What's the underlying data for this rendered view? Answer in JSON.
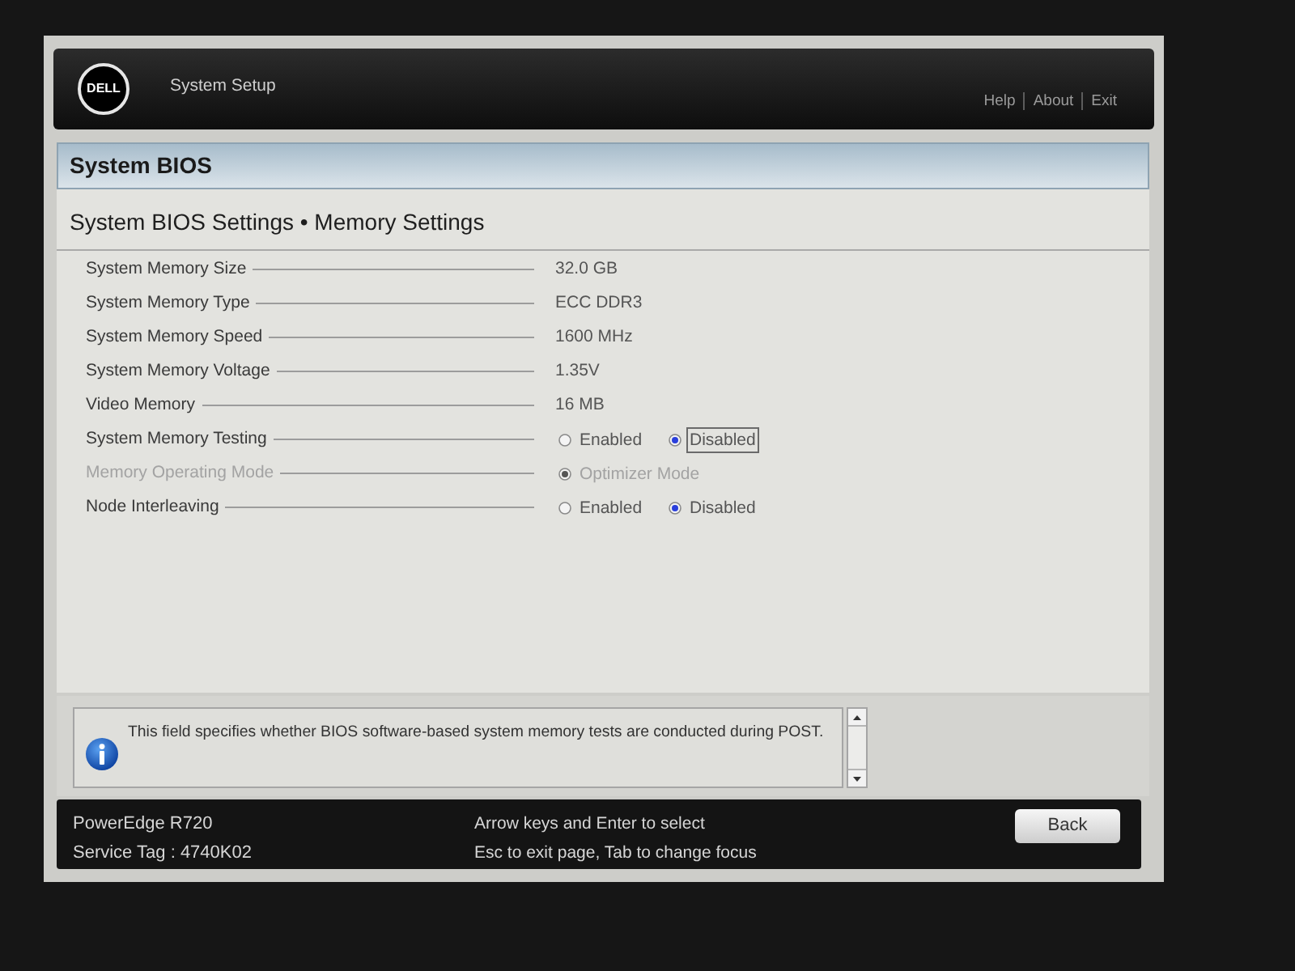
{
  "header": {
    "logo": "DELL",
    "title": "System Setup",
    "links": [
      "Help",
      "About",
      "Exit"
    ]
  },
  "section": {
    "title": "System BIOS"
  },
  "page": {
    "title": "System BIOS Settings • Memory Settings"
  },
  "settings": [
    {
      "label": "System Memory Size",
      "kind": "text",
      "disabled": false,
      "value": "32.0 GB"
    },
    {
      "label": "System Memory Type",
      "kind": "text",
      "disabled": false,
      "value": "ECC DDR3"
    },
    {
      "label": "System Memory Speed",
      "kind": "text",
      "disabled": false,
      "value": "1600 MHz"
    },
    {
      "label": "System Memory Voltage",
      "kind": "text",
      "disabled": false,
      "value": "1.35V"
    },
    {
      "label": "Video Memory",
      "kind": "text",
      "disabled": false,
      "value": "16 MB"
    },
    {
      "label": "System Memory Testing",
      "kind": "radio",
      "disabled": false,
      "options": [
        {
          "label": "Enabled",
          "selected": false,
          "focused": false
        },
        {
          "label": "Disabled",
          "selected": true,
          "focused": true
        }
      ]
    },
    {
      "label": "Memory Operating Mode",
      "kind": "radio",
      "disabled": true,
      "options": [
        {
          "label": "Optimizer Mode",
          "selected": true,
          "focused": false
        }
      ]
    },
    {
      "label": "Node Interleaving",
      "kind": "radio",
      "disabled": false,
      "options": [
        {
          "label": "Enabled",
          "selected": false,
          "focused": false
        },
        {
          "label": "Disabled",
          "selected": true,
          "focused": false
        }
      ]
    }
  ],
  "help": {
    "text": "This field specifies whether BIOS software-based system memory tests are conducted during POST."
  },
  "footer": {
    "model": "PowerEdge R720",
    "service_tag": "Service Tag : 4740K02",
    "hints": [
      "Arrow keys and Enter to select",
      "Esc to exit page, Tab to change focus"
    ],
    "button": "Back"
  }
}
